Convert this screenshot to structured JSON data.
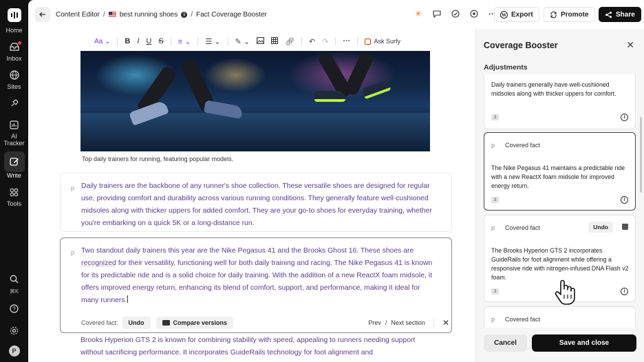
{
  "rail": {
    "items": [
      {
        "label": "Home"
      },
      {
        "label": "Inbox"
      },
      {
        "label": "Sites"
      },
      {
        "label": ""
      },
      {
        "label": "AI Tracker"
      },
      {
        "label": "Write"
      },
      {
        "label": "Tools"
      }
    ],
    "shortcut": "⌘K",
    "avatar_initial": "P"
  },
  "breadcrumb": {
    "root": "Content Editor",
    "doc": "best running shoes",
    "current": "Fact Coverage Booster"
  },
  "header": {
    "export_label": "Export",
    "promote_label": "Promote",
    "share_label": "Share"
  },
  "toolbar": {
    "font_label": "Aa",
    "ask_label": "Ask Surfy"
  },
  "image": {
    "caption": "Top daily trainers for running, featuring popular models."
  },
  "editor": {
    "para1": "Daily trainers are the backbone of any runner's shoe collection. These versatile shoes are designed for regular use, providing comfort and durability across various running conditions. They generally feature well-cushioned midsoles along with thicker uppers for added comfort. They are your go-to shoes for everyday training, whether you're embarking on a quick 5K or a long-distance run.",
    "para2_a": "Two standout daily trainers this year are the Nike Pegasus 41 and the Brooks Ghost 16. These shoes are ",
    "para2_u": "recognized",
    "para2_b": " for their versatility, functioning well for both daily training and racing. The Nike Pegasus 41 is known for its predictable ride and is a solid choice for daily training. With the addition of a new ReactX foam midsole, it offers improved energy return, enhancing its blend of comfort, support, and performance, making it ideal for many runners.",
    "para3": "Brooks Hyperion GTS 2 is known for combining stability with speed, appealing to runners needing support without sacrificing performance. It incorporates GuideRails technology for foot alignment and",
    "block_marker": "p",
    "covered_label": "Covered fact:",
    "undo_label": "Undo",
    "compare_label": "Compare versions",
    "prev_label": "Prev",
    "slash": "/",
    "next_label": "Next section"
  },
  "panel": {
    "title": "Coverage Booster",
    "subtitle": "Adjustments",
    "cards": [
      {
        "text": "Daily trainers generally have well-cushioned midsoles along with thicker uppers for comfort.",
        "badge": "3"
      },
      {
        "marker": "p",
        "head": "Covered fact",
        "text": "The Nike Pegasus 41 maintains a predictable ride with a new ReactX foam midsole for improved energy return.",
        "badge": "3"
      },
      {
        "marker": "p",
        "head": "Covered fact",
        "undo": "Undo",
        "text": "The Brooks Hyperion GTS 2 incorporates GuideRails for foot alignment while offering a responsive ride with nitrogen-infused DNA Flash v2 foam.",
        "badge": "3"
      },
      {
        "marker": "p",
        "head": "Covered fact"
      }
    ],
    "cancel_label": "Cancel",
    "save_label": "Save and close"
  }
}
